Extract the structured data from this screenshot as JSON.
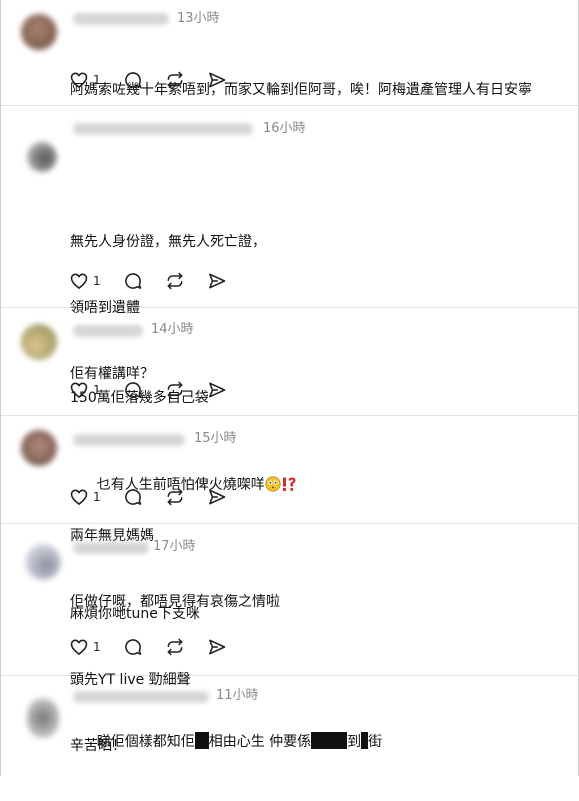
{
  "comments": [
    {
      "time": "13小時",
      "lines": [
        "阿媽索咗幾十年索唔到，而家又輪到佢阿哥，唉！阿梅遺產管理人有日安寧"
      ],
      "likes": "1"
    },
    {
      "time": "16小時",
      "paragraphs": [
        [
          "無先人身份證，無先人死亡證，",
          "領唔到遺體",
          "佢有權講咩？"
        ],
        [
          "兩年無見媽媽",
          "佢做仔嘅，都唔見得有哀傷之情啦"
        ]
      ],
      "likes": "1"
    },
    {
      "time": "14小時",
      "lines": [
        "150萬佢落幾多自己袋"
      ],
      "likes": "1"
    },
    {
      "time": "15小時",
      "text": "乜有人生前唔怕俾火燒㗎咩",
      "emoji": [
        "flushed-face",
        "exclamation-question-mark"
      ],
      "likes": "1"
    },
    {
      "time": "17小時",
      "lines": [
        "麻煩你哋tune下支咪",
        "頭先YT live 勁細聲",
        "辛苦晒！"
      ],
      "likes": "1"
    },
    {
      "time": "11小時",
      "segments": [
        "睇佢個樣都知佢",
        "相由心生 仲要係",
        "到",
        "街"
      ]
    }
  ],
  "icons": {
    "like": "heart-icon",
    "reply": "comment-icon",
    "repost": "repost-icon",
    "share": "share-icon"
  },
  "colors": {
    "text": "#111111",
    "meta": "#8a8a8a",
    "divider": "#e3e3e3",
    "redaction": "#111111"
  }
}
